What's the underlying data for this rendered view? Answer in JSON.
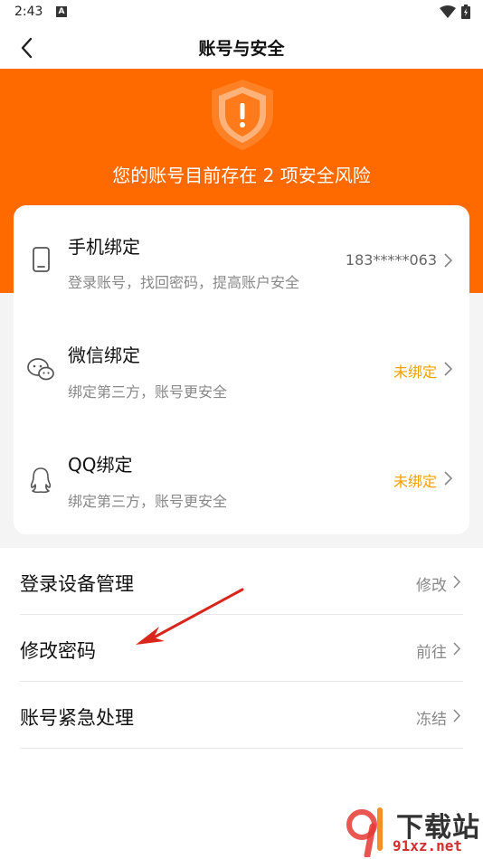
{
  "status_bar": {
    "time": "2:43",
    "notification_badge": "A"
  },
  "nav": {
    "title": "账号与安全"
  },
  "hero": {
    "risk_text": "您的账号目前存在 2 项安全风险",
    "bg_color": "#ff6a00"
  },
  "bindings": [
    {
      "icon": "phone-icon",
      "title": "手机绑定",
      "subtitle": "登录账号，找回密码，提高账户安全",
      "value": "183*****063",
      "value_color": "#666666"
    },
    {
      "icon": "wechat-icon",
      "title": "微信绑定",
      "subtitle": "绑定第三方，账号更安全",
      "value": "未绑定",
      "value_color": "#f5a000"
    },
    {
      "icon": "qq-icon",
      "title": "QQ绑定",
      "subtitle": "绑定第三方，账号更安全",
      "value": "未绑定",
      "value_color": "#f5a000"
    }
  ],
  "menu": [
    {
      "label": "登录设备管理",
      "action": "修改"
    },
    {
      "label": "修改密码",
      "action": "前往"
    },
    {
      "label": "账号紧急处理",
      "action": "冻结"
    }
  ],
  "watermark": {
    "brand": "下载站",
    "domain": "91xz.net"
  }
}
